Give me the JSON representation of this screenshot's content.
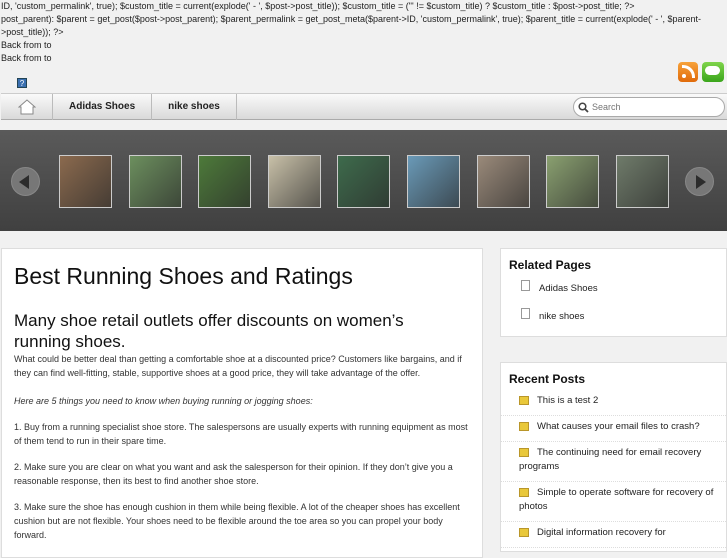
{
  "debug_lines": [
    "ID, 'custom_permalink', true); $custom_title = current(explode(' - ', $post->post_title)); $custom_title = (\"' != $custom_title) ? $custom_title : $post->post_title; ?>",
    "post_parent): $parent = get_post($post->post_parent); $parent_permalink = get_post_meta($parent->ID, 'custom_permalink', true); $parent_title = current(explode(' - ', $parent->post_title)); ?>",
    "Back from to",
    "Back from to"
  ],
  "help_icon": "?",
  "nav": {
    "items": [
      "Adidas Shoes",
      "nike shoes"
    ],
    "search_placeholder": "Search"
  },
  "gallery": {
    "thumbnails": [
      {
        "icon": "photo-people-table",
        "color": "#8b6a4e"
      },
      {
        "icon": "photo-team",
        "color": "#6c8f5e"
      },
      {
        "icon": "photo-river",
        "color": "#4d7a3a"
      },
      {
        "icon": "photo-tshirt",
        "color": "#c8c0a8"
      },
      {
        "icon": "photo-group",
        "color": "#3e6b4c"
      },
      {
        "icon": "photo-map",
        "color": "#6a9ab8"
      },
      {
        "icon": "photo-man",
        "color": "#9a8a7a"
      },
      {
        "icon": "photo-house",
        "color": "#8aa070"
      },
      {
        "icon": "photo-building",
        "color": "#6f7b6a"
      }
    ]
  },
  "article": {
    "title": "Best Running Shoes and Ratings",
    "subtitle": "Many shoe retail outlets offer discounts on women’s running shoes.",
    "paragraphs": [
      "What could be better deal than getting a comfortable shoe at a discounted price? Customers like bargains, and if they can find well-fitting, stable, supportive shoes at a good price, they will take advantage of the offer.",
      "Here are 5 things you need to know when buying running or jogging shoes:",
      "1. Buy from a running specialist shoe store. The salespersons are usually experts with running equipment as most of them tend to run in their spare time.",
      "2. Make sure you are clear on what you want and ask the salesperson for their opinion. If they don’t give you a reasonable response, then its best to find another shoe store.",
      "3. Make sure the shoe has enough cushion in them while being flexible. A lot of the cheaper shoes has excellent cushion but are not flexible. Your shoes need to be flexible around the toe area so you can propel your body forward."
    ]
  },
  "related_pages": {
    "heading": "Related Pages",
    "items": [
      "Adidas Shoes",
      "nike shoes"
    ]
  },
  "recent_posts": {
    "heading": "Recent Posts",
    "items": [
      "This is a test 2",
      "What causes your email files to crash?",
      "The continuing need for email recovery programs",
      "Simple to operate software for recovery of photos",
      "Digital information recovery for"
    ]
  }
}
